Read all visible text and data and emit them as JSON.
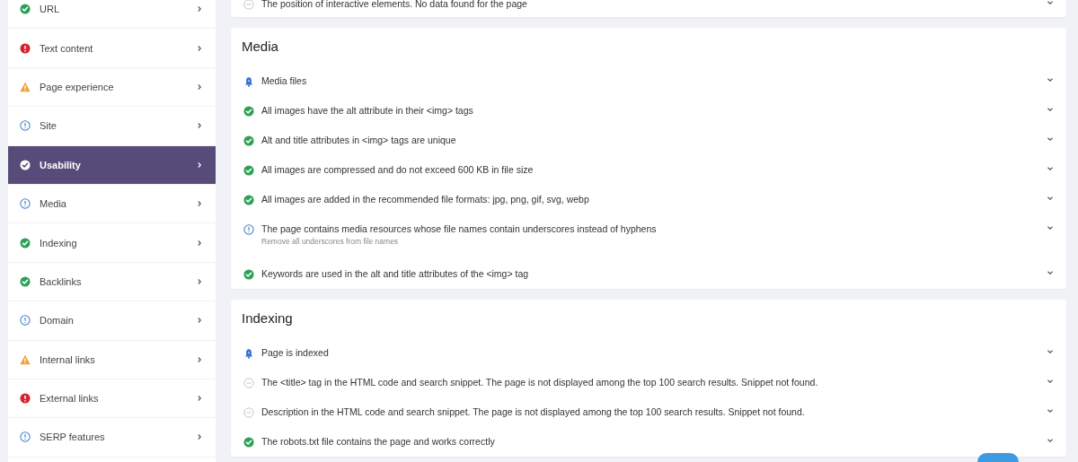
{
  "sidebar": {
    "items": [
      {
        "label": "URL",
        "kind": "pass",
        "selected": false
      },
      {
        "label": "Text content",
        "kind": "error",
        "selected": false
      },
      {
        "label": "Page experience",
        "kind": "warning",
        "selected": false
      },
      {
        "label": "Site",
        "kind": "info",
        "selected": false
      },
      {
        "label": "Usability",
        "kind": "pass",
        "selected": true
      },
      {
        "label": "Media",
        "kind": "info",
        "selected": false
      },
      {
        "label": "Indexing",
        "kind": "pass",
        "selected": false
      },
      {
        "label": "Backlinks",
        "kind": "pass",
        "selected": false
      },
      {
        "label": "Domain",
        "kind": "info",
        "selected": false
      },
      {
        "label": "Internal links",
        "kind": "warning",
        "selected": false
      },
      {
        "label": "External links",
        "kind": "error",
        "selected": false
      },
      {
        "label": "SERP features",
        "kind": "info",
        "selected": false
      }
    ]
  },
  "sections": [
    {
      "checks": [
        {
          "kind": "neutral",
          "text": "The position of interactive elements. No data found for the page"
        }
      ]
    },
    {
      "title": "Media",
      "checks": [
        {
          "kind": "notice",
          "text": "Media files"
        },
        {
          "kind": "pass",
          "text": "All images have the alt attribute in their <img> tags"
        },
        {
          "kind": "pass",
          "text": "Alt and title attributes in <img> tags are unique"
        },
        {
          "kind": "pass",
          "text": "All images are compressed and do not exceed 600 KB in file size"
        },
        {
          "kind": "pass",
          "text": "All images are added in the recommended file formats: jpg, png, gif, svg, webp"
        },
        {
          "kind": "info",
          "text": "The page contains media resources whose file names contain underscores instead of hyphens",
          "hint": "Remove all underscores from file names"
        },
        {
          "kind": "pass",
          "text": "Keywords are used in the alt and title attributes of the <img> tag"
        }
      ]
    },
    {
      "title": "Indexing",
      "checks": [
        {
          "kind": "notice",
          "text": "Page is indexed"
        },
        {
          "kind": "neutral",
          "text": "The <title> tag in the HTML code and search snippet. The page is not displayed among the top 100 search results. Snippet not found."
        },
        {
          "kind": "neutral",
          "text": "Description in the HTML code and search snippet. The page is not displayed among the top 100 search results. Snippet not found."
        },
        {
          "kind": "pass",
          "text": "The robots.txt file contains the page and works correctly"
        }
      ]
    }
  ]
}
